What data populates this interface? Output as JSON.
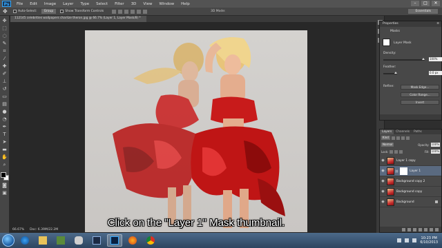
{
  "app": {
    "logo": "Ps",
    "menu": [
      "File",
      "Edit",
      "Image",
      "Layer",
      "Type",
      "Select",
      "Filter",
      "3D",
      "View",
      "Window",
      "Help"
    ],
    "window_controls": [
      "–",
      "□",
      "✕"
    ]
  },
  "options_bar": {
    "auto_select_label": "Auto-Select:",
    "auto_select_value": "Group",
    "show_transform_label": "Show Transform Controls",
    "mode_3d_label": "3D Mode:",
    "workspace": "Essentials"
  },
  "document": {
    "tab_title": "112145 celebrities wallpapers charlize theron.jpg @ 66.7% (Layer 1, Layer Mask/8) *",
    "zoom": "66.67%",
    "doc_size": "Doc: 6.39M/22.2M",
    "caption": "Click on the \"Layer 1\" Mask thumbnail."
  },
  "properties": {
    "title": "Properties",
    "panel_label": "Masks",
    "layer_mask_label": "Layer Mask",
    "density_label": "Density:",
    "density_value": "100%",
    "feather_label": "Feather:",
    "feather_value": "0.0 px",
    "refine_label": "Refine:",
    "btn_mask_edge": "Mask Edge...",
    "btn_color_range": "Color Range...",
    "btn_invert": "Invert"
  },
  "layers_panel": {
    "tabs": [
      "Layers",
      "Channels",
      "Paths"
    ],
    "kind": "Kind",
    "blend_mode": "Normal",
    "opacity_label": "Opacity:",
    "opacity_value": "100%",
    "lock_label": "Lock:",
    "fill_label": "Fill:",
    "fill_value": "100%",
    "layers": [
      {
        "name": "Layer 1 copy",
        "selected": false
      },
      {
        "name": "Layer 1",
        "selected": true
      },
      {
        "name": "Background copy 2",
        "selected": false
      },
      {
        "name": "Background copy",
        "selected": false
      },
      {
        "name": "Background",
        "selected": false
      }
    ]
  },
  "taskbar": {
    "time": "10:23 PM",
    "date": "6/10/2013"
  }
}
